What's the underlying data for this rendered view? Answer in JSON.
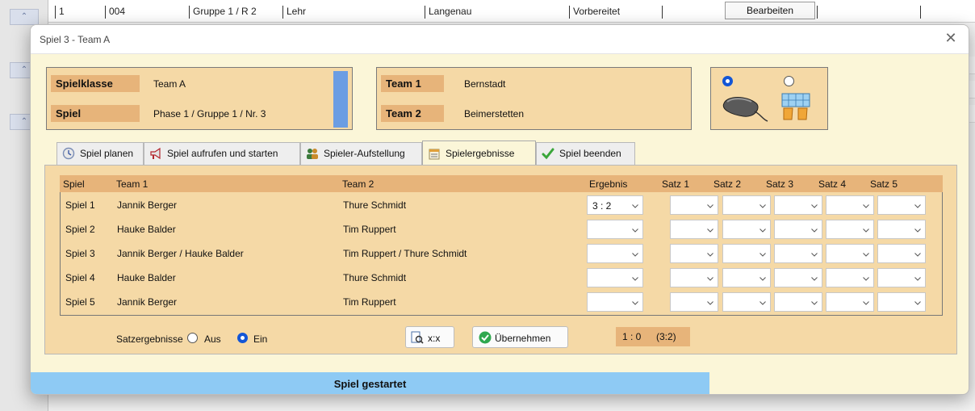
{
  "background": {
    "row": {
      "nr": "1",
      "id": "004",
      "group": "Gruppe 1 / R 2",
      "type": "Lehr",
      "location": "Langenau",
      "state": "Vorbereitet",
      "button": "Bearbeiten"
    }
  },
  "dialog": {
    "title": "Spiel 3 - Team A",
    "close": "✕",
    "info": {
      "spielklasse_label": "Spielklasse",
      "spielklasse_value": "Team A",
      "spiel_label": "Spiel",
      "spiel_value": "Phase 1 / Gruppe 1 / Nr. 3",
      "team1_label": "Team 1",
      "team1_value": "Bernstadt",
      "team2_label": "Team 2",
      "team2_value": "Beimerstetten"
    },
    "tabs": [
      {
        "label": "Spiel planen",
        "icon": "clock-icon"
      },
      {
        "label": "Spiel aufrufen und starten",
        "icon": "megaphone-icon"
      },
      {
        "label": "Spieler-Aufstellung",
        "icon": "players-icon"
      },
      {
        "label": "Spielergebnisse",
        "icon": "results-icon",
        "active": true
      },
      {
        "label": "Spiel beenden",
        "icon": "checkmark-icon"
      }
    ],
    "grid": {
      "headers": {
        "spiel": "Spiel",
        "team1": "Team 1",
        "team2": "Team 2",
        "ergebnis": "Ergebnis",
        "satz1": "Satz 1",
        "satz2": "Satz 2",
        "satz3": "Satz 3",
        "satz4": "Satz 4",
        "satz5": "Satz 5"
      },
      "rows": [
        {
          "spiel": "Spiel 1",
          "team1": "Jannik Berger",
          "team2": "Thure Schmidt",
          "ergebnis": "3 : 2"
        },
        {
          "spiel": "Spiel 2",
          "team1": "Hauke Balder",
          "team2": "Tim Ruppert",
          "ergebnis": ""
        },
        {
          "spiel": "Spiel 3",
          "team1": "Jannik Berger / Hauke Balder",
          "team2": "Tim Ruppert / Thure Schmidt",
          "ergebnis": ""
        },
        {
          "spiel": "Spiel 4",
          "team1": "Hauke Balder",
          "team2": "Thure Schmidt",
          "ergebnis": ""
        },
        {
          "spiel": "Spiel 5",
          "team1": "Jannik Berger",
          "team2": "Tim Ruppert",
          "ergebnis": ""
        }
      ]
    },
    "footer": {
      "satzergebnisse_label": "Satzergebnisse",
      "aus_label": "Aus",
      "ein_label": "Ein",
      "xx_button": "x:x",
      "uebernehmen_button": "Übernehmen",
      "score_main": "1 : 0",
      "score_sets": "(3:2)"
    },
    "status": "Spiel gestartet"
  },
  "colors": {
    "accent": "#e7b47a",
    "panel": "#f5d9a6",
    "dialog_bg": "#fbf6d8",
    "status_bar": "#8ecaf4",
    "radio_selected": "#1356d6"
  }
}
